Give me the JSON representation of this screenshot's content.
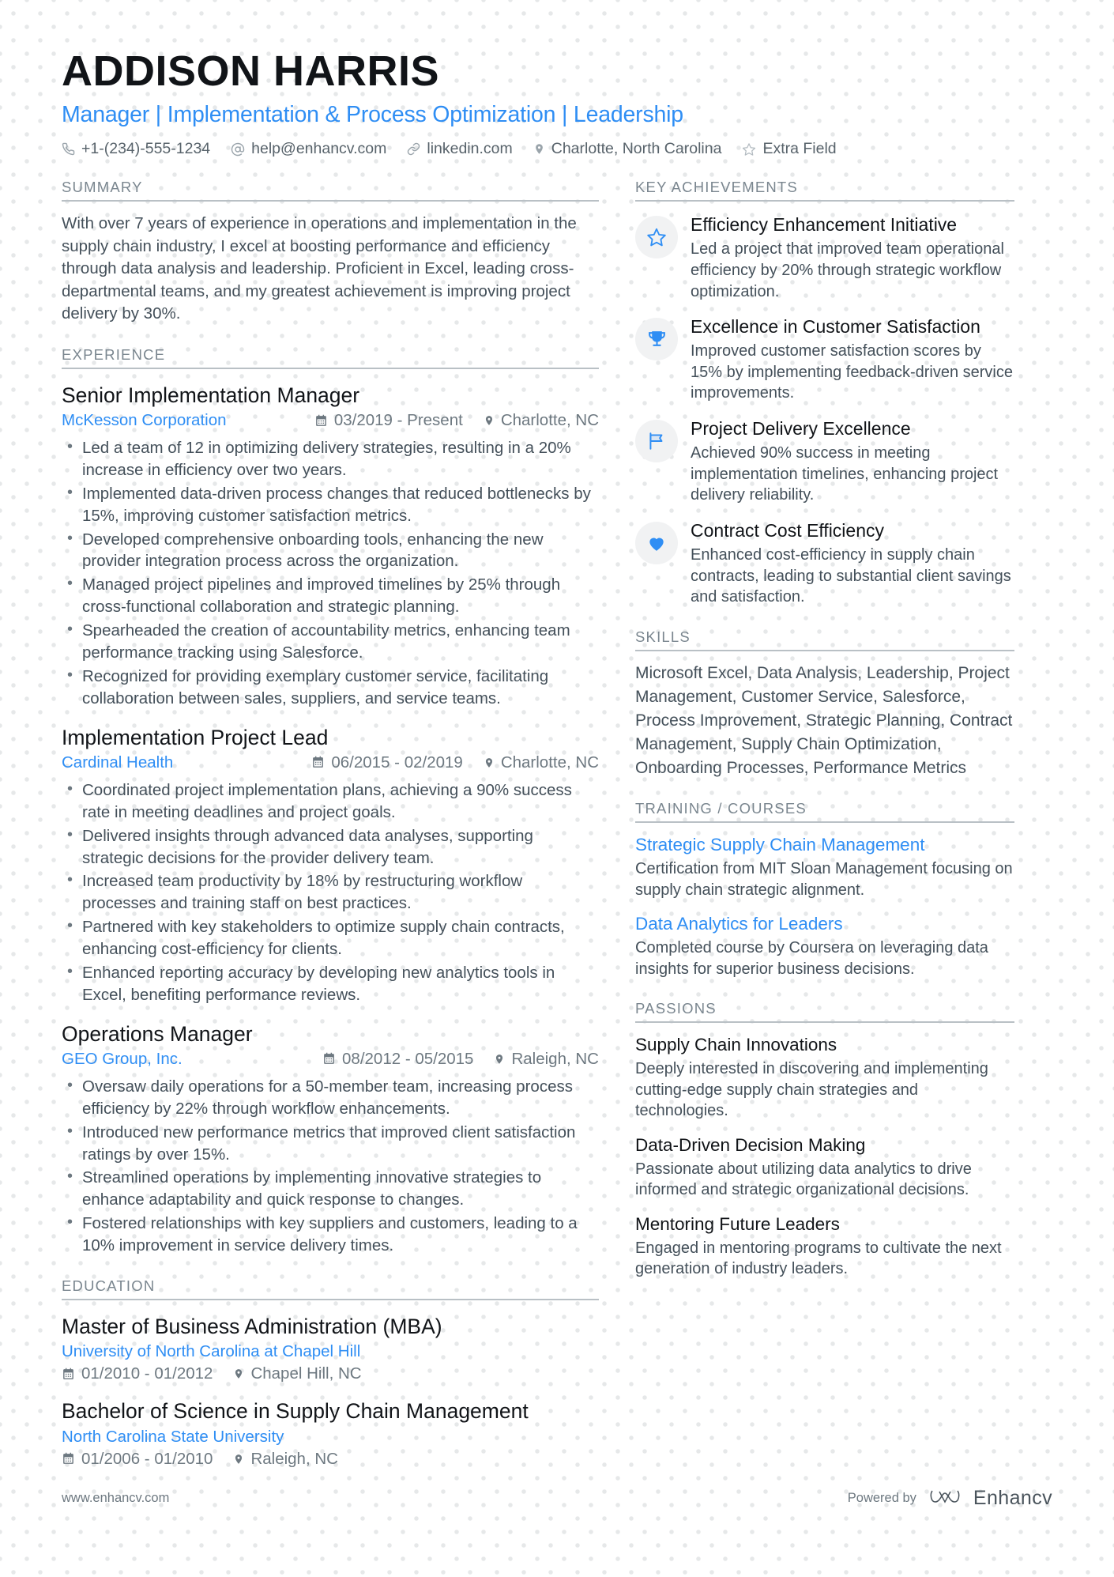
{
  "header": {
    "name": "ADDISON HARRIS",
    "headline": "Manager | Implementation & Process Optimization | Leadership",
    "contacts": [
      {
        "icon": "phone-icon",
        "text": "+1-(234)-555-1234"
      },
      {
        "icon": "email-icon",
        "text": "help@enhancv.com"
      },
      {
        "icon": "link-icon",
        "text": "linkedin.com"
      },
      {
        "icon": "location-icon",
        "text": "Charlotte, North Carolina"
      },
      {
        "icon": "star-icon",
        "text": "Extra Field"
      }
    ]
  },
  "sections": {
    "summary_title": "SUMMARY",
    "experience_title": "EXPERIENCE",
    "education_title": "EDUCATION",
    "achievements_title": "KEY ACHIEVEMENTS",
    "skills_title": "SKILLS",
    "training_title": "TRAINING / COURSES",
    "passions_title": "PASSIONS"
  },
  "summary": "With over 7 years of experience in operations and implementation in the supply chain industry, I excel at boosting performance and efficiency through data analysis and leadership. Proficient in Excel, leading cross-departmental teams, and my greatest achievement is improving project delivery by 30%.",
  "experience": [
    {
      "title": "Senior Implementation Manager",
      "company": "McKesson Corporation",
      "dates": "03/2019 - Present",
      "location": "Charlotte, NC",
      "bullets": [
        "Led a team of 12 in optimizing delivery strategies, resulting in a 20% increase in efficiency over two years.",
        "Implemented data-driven process changes that reduced bottlenecks by 15%, improving customer satisfaction metrics.",
        "Developed comprehensive onboarding tools, enhancing the new provider integration process across the organization.",
        "Managed project pipelines and improved timelines by 25% through cross-functional collaboration and strategic planning.",
        "Spearheaded the creation of accountability metrics, enhancing team performance tracking using Salesforce.",
        "Recognized for providing exemplary customer service, facilitating collaboration between sales, suppliers, and service teams."
      ]
    },
    {
      "title": "Implementation Project Lead",
      "company": "Cardinal Health",
      "dates": "06/2015 - 02/2019",
      "location": "Charlotte, NC",
      "bullets": [
        "Coordinated project implementation plans, achieving a 90% success rate in meeting deadlines and project goals.",
        "Delivered insights through advanced data analyses, supporting strategic decisions for the provider delivery team.",
        "Increased team productivity by 18% by restructuring workflow processes and training staff on best practices.",
        "Partnered with key stakeholders to optimize supply chain contracts, enhancing cost-efficiency for clients.",
        "Enhanced reporting accuracy by developing new analytics tools in Excel, benefiting performance reviews."
      ]
    },
    {
      "title": "Operations Manager",
      "company": "GEO Group, Inc.",
      "dates": "08/2012 - 05/2015",
      "location": "Raleigh, NC",
      "bullets": [
        "Oversaw daily operations for a 50-member team, increasing process efficiency by 22% through workflow enhancements.",
        "Introduced new performance metrics that improved client satisfaction ratings by over 15%.",
        "Streamlined operations by implementing innovative strategies to enhance adaptability and quick response to changes.",
        "Fostered relationships with key suppliers and customers, leading to a 10% improvement in service delivery times."
      ]
    }
  ],
  "education": [
    {
      "degree": "Master of Business Administration (MBA)",
      "school": "University of North Carolina at Chapel Hill",
      "dates": "01/2010 - 01/2012",
      "location": "Chapel Hill, NC"
    },
    {
      "degree": "Bachelor of Science in Supply Chain Management",
      "school": "North Carolina State University",
      "dates": "01/2006 - 01/2010",
      "location": "Raleigh, NC"
    }
  ],
  "achievements": [
    {
      "icon": "star-outline-icon",
      "title": "Efficiency Enhancement Initiative",
      "desc": "Led a project that improved team operational efficiency by 20% through strategic workflow optimization."
    },
    {
      "icon": "trophy-icon",
      "title": "Excellence in Customer Satisfaction",
      "desc": "Improved customer satisfaction scores by 15% by implementing feedback-driven service improvements."
    },
    {
      "icon": "flag-icon",
      "title": "Project Delivery Excellence",
      "desc": "Achieved 90% success in meeting implementation timelines, enhancing project delivery reliability."
    },
    {
      "icon": "heart-icon",
      "title": "Contract Cost Efficiency",
      "desc": "Enhanced cost-efficiency in supply chain contracts, leading to substantial client savings and satisfaction."
    }
  ],
  "skills": "Microsoft Excel, Data Analysis, Leadership, Project Management, Customer Service, Salesforce, Process Improvement, Strategic Planning, Contract Management, Supply Chain Optimization, Onboarding Processes, Performance Metrics",
  "training": [
    {
      "title": "Strategic Supply Chain Management",
      "desc": "Certification from MIT Sloan Management focusing on supply chain strategic alignment."
    },
    {
      "title": "Data Analytics for Leaders",
      "desc": "Completed course by Coursera on leveraging data insights for superior business decisions."
    }
  ],
  "passions": [
    {
      "title": "Supply Chain Innovations",
      "desc": "Deeply interested in discovering and implementing cutting-edge supply chain strategies and technologies."
    },
    {
      "title": "Data-Driven Decision Making",
      "desc": "Passionate about utilizing data analytics to drive informed and strategic organizational decisions."
    },
    {
      "title": "Mentoring Future Leaders",
      "desc": "Engaged in mentoring programs to cultivate the next generation of industry leaders."
    }
  ],
  "footer": {
    "website": "www.enhancv.com",
    "powered_by": "Powered by",
    "brand": "Enhancv"
  },
  "colors": {
    "accent": "#2f8ef4",
    "text": "#44505a",
    "heading": "#111418",
    "muted": "#7a868f"
  }
}
